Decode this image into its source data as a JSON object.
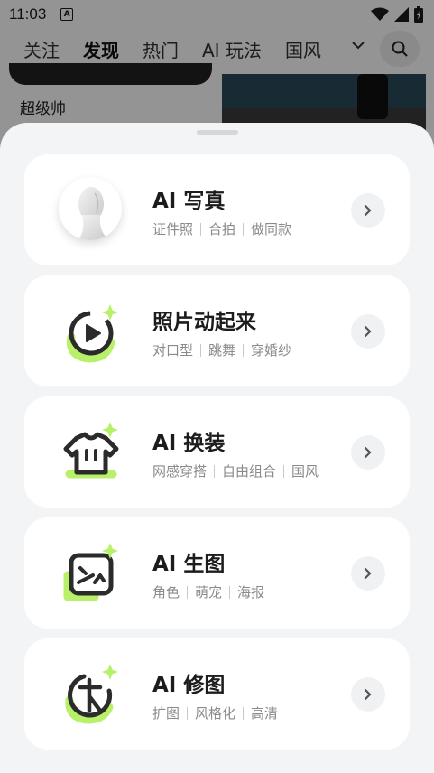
{
  "status_bar": {
    "time": "11:03",
    "notification_letter": "A"
  },
  "top_tabs": [
    {
      "label": "关注",
      "active": false
    },
    {
      "label": "发现",
      "active": true
    },
    {
      "label": "热门",
      "active": false
    },
    {
      "label": "AI 玩法",
      "active": false
    },
    {
      "label": "国风",
      "active": false
    }
  ],
  "background": {
    "card_title": "超级帅"
  },
  "sheet": {
    "items": [
      {
        "title": "AI 写真",
        "tags": [
          "证件照",
          "合拍",
          "做同款"
        ],
        "icon": "portrait-mannequin-icon"
      },
      {
        "title": "照片动起来",
        "tags": [
          "对口型",
          "跳舞",
          "穿婚纱"
        ],
        "icon": "play-circle-icon"
      },
      {
        "title": "AI 换装",
        "tags": [
          "网感穿搭",
          "自由组合",
          "国风"
        ],
        "icon": "tshirt-icon"
      },
      {
        "title": "AI 生图",
        "tags": [
          "角色",
          "萌宠",
          "海报"
        ],
        "icon": "image-generate-icon"
      },
      {
        "title": "AI 修图",
        "tags": [
          "扩图",
          "风格化",
          "高清"
        ],
        "icon": "image-edit-icon"
      }
    ]
  },
  "colors": {
    "accent": "#b8f06a",
    "sheet_bg": "#f3f4f6",
    "card_bg": "#ffffff",
    "icon_dark": "#2b2b2b"
  }
}
